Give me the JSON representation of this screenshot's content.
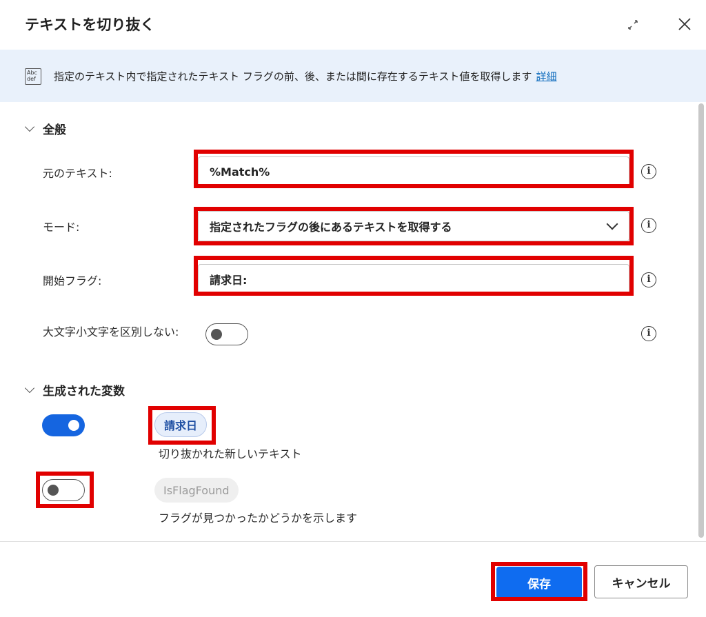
{
  "dialog": {
    "title": "テキストを切り抜く"
  },
  "banner": {
    "icon_text": "Abc def",
    "text": "指定のテキスト内で指定されたテキスト フラグの前、後、または間に存在するテキスト値を取得します",
    "link": "詳細"
  },
  "general": {
    "heading": "全般",
    "original_text_label": "元のテキスト:",
    "original_text_value": "%Match%",
    "mode_label": "モード:",
    "mode_value": "指定されたフラグの後にあるテキストを取得する",
    "start_flag_label": "開始フラグ:",
    "start_flag_value": "請求日:",
    "ignore_case_label": "大文字小文字を区別しない:",
    "ignore_case_on": false
  },
  "variables": {
    "heading": "生成された変数",
    "items": [
      {
        "name": "請求日",
        "description": "切り抜かれた新しいテキスト",
        "enabled": true
      },
      {
        "name": "IsFlagFound",
        "description": "フラグが見つかったかどうかを示します",
        "enabled": false
      }
    ]
  },
  "footer": {
    "save": "保存",
    "cancel": "キャンセル"
  },
  "colors": {
    "highlight": "#e10000",
    "primary": "#0f6cf0",
    "banner_bg": "#e9f1fb",
    "link": "#0f6cbd"
  },
  "icons": [
    "expand-icon",
    "close-icon",
    "text-icon",
    "info-icon",
    "chevron-down-icon"
  ]
}
